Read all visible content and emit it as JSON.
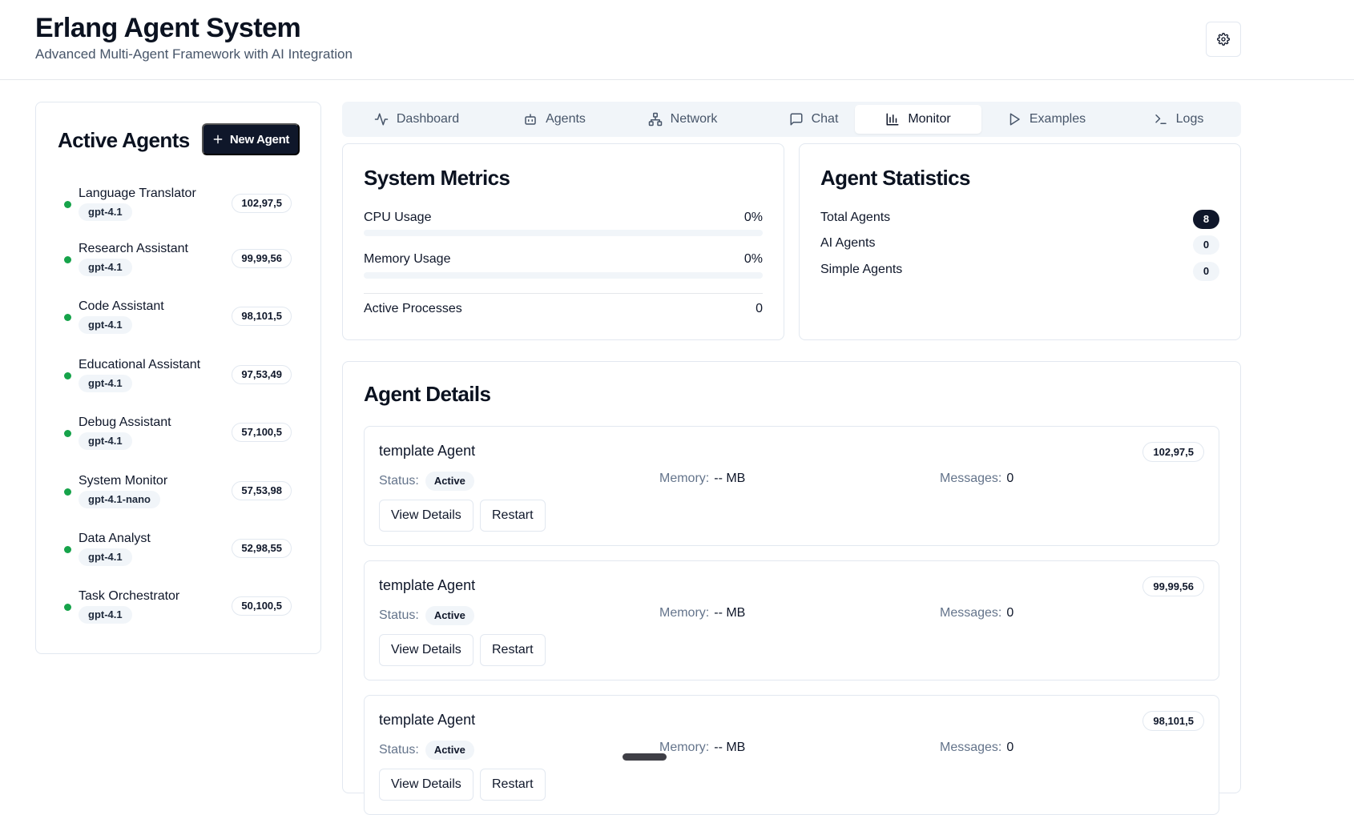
{
  "header": {
    "title": "Erlang Agent System",
    "subtitle": "Advanced Multi-Agent Framework with AI Integration",
    "settings_icon": "gear-icon"
  },
  "sidebar": {
    "title": "Active Agents",
    "new_agent_label": "New Agent",
    "agents": [
      {
        "name": "Language Translator",
        "model": "gpt-4.1",
        "coords": "102,97,5",
        "status_color": "#16a34a"
      },
      {
        "name": "Research Assistant",
        "model": "gpt-4.1",
        "coords": "99,99,56",
        "status_color": "#16a34a"
      },
      {
        "name": "Code Assistant",
        "model": "gpt-4.1",
        "coords": "98,101,5",
        "status_color": "#16a34a"
      },
      {
        "name": "Educational Assistant",
        "model": "gpt-4.1",
        "coords": "97,53,49",
        "status_color": "#16a34a"
      },
      {
        "name": "Debug Assistant",
        "model": "gpt-4.1",
        "coords": "57,100,5",
        "status_color": "#16a34a"
      },
      {
        "name": "System Monitor",
        "model": "gpt-4.1-nano",
        "coords": "57,53,98",
        "status_color": "#16a34a"
      },
      {
        "name": "Data Analyst",
        "model": "gpt-4.1",
        "coords": "52,98,55",
        "status_color": "#16a34a"
      },
      {
        "name": "Task Orchestrator",
        "model": "gpt-4.1",
        "coords": "50,100,5",
        "status_color": "#16a34a"
      }
    ]
  },
  "tabs": [
    {
      "label": "Dashboard",
      "icon": "activity-icon",
      "active": false
    },
    {
      "label": "Agents",
      "icon": "bot-icon",
      "active": false
    },
    {
      "label": "Network",
      "icon": "network-icon",
      "active": false
    },
    {
      "label": "Chat",
      "icon": "chat-icon",
      "active": false
    },
    {
      "label": "Monitor",
      "icon": "bar-chart-icon",
      "active": true
    },
    {
      "label": "Examples",
      "icon": "play-icon",
      "active": false
    },
    {
      "label": "Logs",
      "icon": "terminal-icon",
      "active": false
    }
  ],
  "system_metrics": {
    "title": "System Metrics",
    "cpu_label": "CPU Usage",
    "cpu_value": "0%",
    "cpu_fraction": 0,
    "memory_label": "Memory Usage",
    "memory_value": "0%",
    "memory_fraction": 0,
    "processes_label": "Active Processes",
    "processes_value": "0"
  },
  "agent_statistics": {
    "title": "Agent Statistics",
    "total_label": "Total Agents",
    "total_value": "8",
    "ai_label": "AI Agents",
    "ai_value": "0",
    "simple_label": "Simple Agents",
    "simple_value": "0"
  },
  "agent_details": {
    "title": "Agent Details",
    "status_label": "Status:",
    "memory_label": "Memory:",
    "messages_label": "Messages:",
    "view_details_label": "View Details",
    "restart_label": "Restart",
    "items": [
      {
        "name": "template Agent",
        "coords": "102,97,5",
        "status": "Active",
        "memory": "-- MB",
        "messages": "0"
      },
      {
        "name": "template Agent",
        "coords": "99,99,56",
        "status": "Active",
        "memory": "-- MB",
        "messages": "0"
      },
      {
        "name": "template Agent",
        "coords": "98,101,5",
        "status": "Active",
        "memory": "-- MB",
        "messages": "0"
      }
    ]
  },
  "colors": {
    "primary": "#0f172a",
    "online": "#16a34a",
    "muted_bg": "#f1f5f9",
    "border": "#e2e8f0"
  }
}
